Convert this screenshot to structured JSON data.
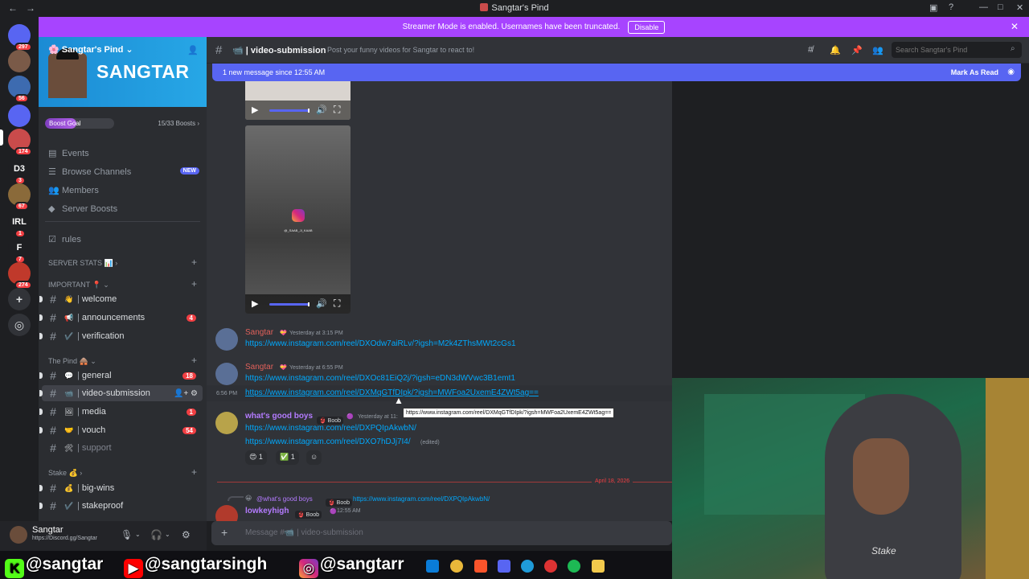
{
  "window": {
    "title": "Sangtar's Pind"
  },
  "rail": {
    "servers": [
      {
        "label": "",
        "count": "297",
        "color": "#5865f2",
        "icon": "discord-home-icon"
      },
      {
        "label": "",
        "count": "",
        "color": "#7a5a48",
        "icon": "server-avatar"
      },
      {
        "label": "",
        "count": "56",
        "color": "#3d6bb0",
        "icon": "server-avatar"
      },
      {
        "label": "",
        "count": "",
        "color": "#5865f2",
        "icon": "folder-icon"
      },
      {
        "label": "",
        "count": "174",
        "color": "#c94b4b",
        "icon": "server-avatar"
      },
      {
        "label": "D3",
        "count": "3",
        "color": "#1e1f22",
        "icon": "server-avatar"
      },
      {
        "label": "",
        "count": "67",
        "color": "#8a6a3a",
        "icon": "server-avatar"
      },
      {
        "label": "IRL",
        "count": "1",
        "color": "#1e1f22",
        "icon": "server-avatar"
      },
      {
        "label": "F",
        "count": "7",
        "color": "#1e1f22",
        "icon": "server-avatar"
      },
      {
        "label": "",
        "count": "274",
        "color": "#c0392b",
        "icon": "server-avatar"
      }
    ]
  },
  "streamer_bar": {
    "text": "Streamer Mode is enabled. Usernames have been truncated.",
    "button": "Disable"
  },
  "server": {
    "name": "Sangtar's Pind",
    "banner_text": "SANGTAR",
    "boost_goal": "Boost Goal",
    "boost_count": "15/33 Boosts",
    "boost_progress": 0.45
  },
  "nav": [
    {
      "label": "Events",
      "icon": "calendar-icon"
    },
    {
      "label": "Browse Channels",
      "icon": "browse-channels-icon",
      "badge": "NEW"
    },
    {
      "label": "Members",
      "icon": "members-icon"
    },
    {
      "label": "Server Boosts",
      "icon": "boost-icon"
    }
  ],
  "rules": "rules",
  "categories": {
    "stats": "SERVER STATS 📊",
    "important": "IMPORTANT 📍",
    "pind": "The Pind 🛖",
    "stake": "Stake 💰"
  },
  "channels": [
    {
      "emoji": "👋",
      "name": "welcome",
      "badge": ""
    },
    {
      "emoji": "📢",
      "name": "announcements",
      "badge": "4"
    },
    {
      "emoji": "✔️",
      "name": "verification",
      "badge": ""
    },
    {
      "emoji": "💬",
      "name": "general",
      "badge": "18"
    },
    {
      "emoji": "📹",
      "name": "video-submission",
      "badge": ""
    },
    {
      "emoji": "🖼",
      "name": "media",
      "badge": "1"
    },
    {
      "emoji": "🤝",
      "name": "vouch",
      "badge": "54"
    },
    {
      "emoji": "🛠",
      "name": "support",
      "badge": ""
    },
    {
      "emoji": "💰",
      "name": "big-wins",
      "badge": ""
    },
    {
      "emoji": "✔️",
      "name": "stakeproof",
      "badge": ""
    }
  ],
  "user": {
    "name": "Sangtar",
    "link": "https://Discord.gg/Sangtar"
  },
  "header": {
    "channel": "video-submission",
    "topic": "Post your funny videos for Sangtar to react to!",
    "search_placeholder": "Search Sangtar's Pind"
  },
  "new_messages": {
    "text": "1 new message since 12:55 AM",
    "action": "Mark As Read"
  },
  "video": {
    "watermark": "@_SAAB_JI_KAAB"
  },
  "messages": [
    {
      "author": "Sangtar",
      "time": "Yesterday at 3:15 PM",
      "links": [
        "https://www.instagram.com/reel/DXOdw7aiRLv/?igsh=M2k4ZThsMWt2cGs1"
      ]
    },
    {
      "author": "Sangtar",
      "time": "Yesterday at 6:55 PM",
      "links": [
        "https://www.instagram.com/reel/DXOc81EiQ2j/?igsh=eDN3dWVwc3B1emt1",
        "https://www.instagram.com/reel/DXMqGTfDIpk/?igsh=MWFoa2UxemE4ZWt5ag=="
      ],
      "hover_time": "6:56 PM"
    },
    {
      "author": "what's good boys",
      "time": "Yesterday at 11:",
      "tag": "Boob",
      "links": [
        "https://www.instagram.com/reel/DXPQIpAkwbN/",
        "https://www.instagram.com/reel/DXO7hDJj7I4/"
      ],
      "edited": "(edited)"
    }
  ],
  "tooltip": "https://www.instagram.com/reel/DXMqGTfDIpk/?igsh=MWFoa2UxemE4ZWt5ag==",
  "reactions": [
    {
      "emoji": "😍",
      "count": "1"
    },
    {
      "emoji": "✅",
      "count": "1"
    },
    {
      "emoji": "☺",
      "count": ""
    }
  ],
  "date_divider": "April 18, 2026",
  "reply": {
    "ref_author": "@what's good boys",
    "ref_tag": "Boob",
    "ref_link": "https://www.instagram.com/reel/DXPQIpAkwbN/",
    "author": "lowkeyhigh",
    "tag": "Boob",
    "time": "12:55 AM"
  },
  "composer": {
    "placeholder": "Message #📹 | video-submission"
  },
  "webcam": {
    "logo": "Stake"
  },
  "overlay": {
    "kick": "@sangtar",
    "youtube": "@sangtarsingh",
    "instagram": "@sangtarr"
  },
  "colors": {
    "accent": "#5865f2",
    "streamer": "#a744ff",
    "author_sangtar": "#e0605a",
    "author_wgb": "#b47bff",
    "link": "#00a8fc",
    "mention_badge": "#f23f43"
  }
}
